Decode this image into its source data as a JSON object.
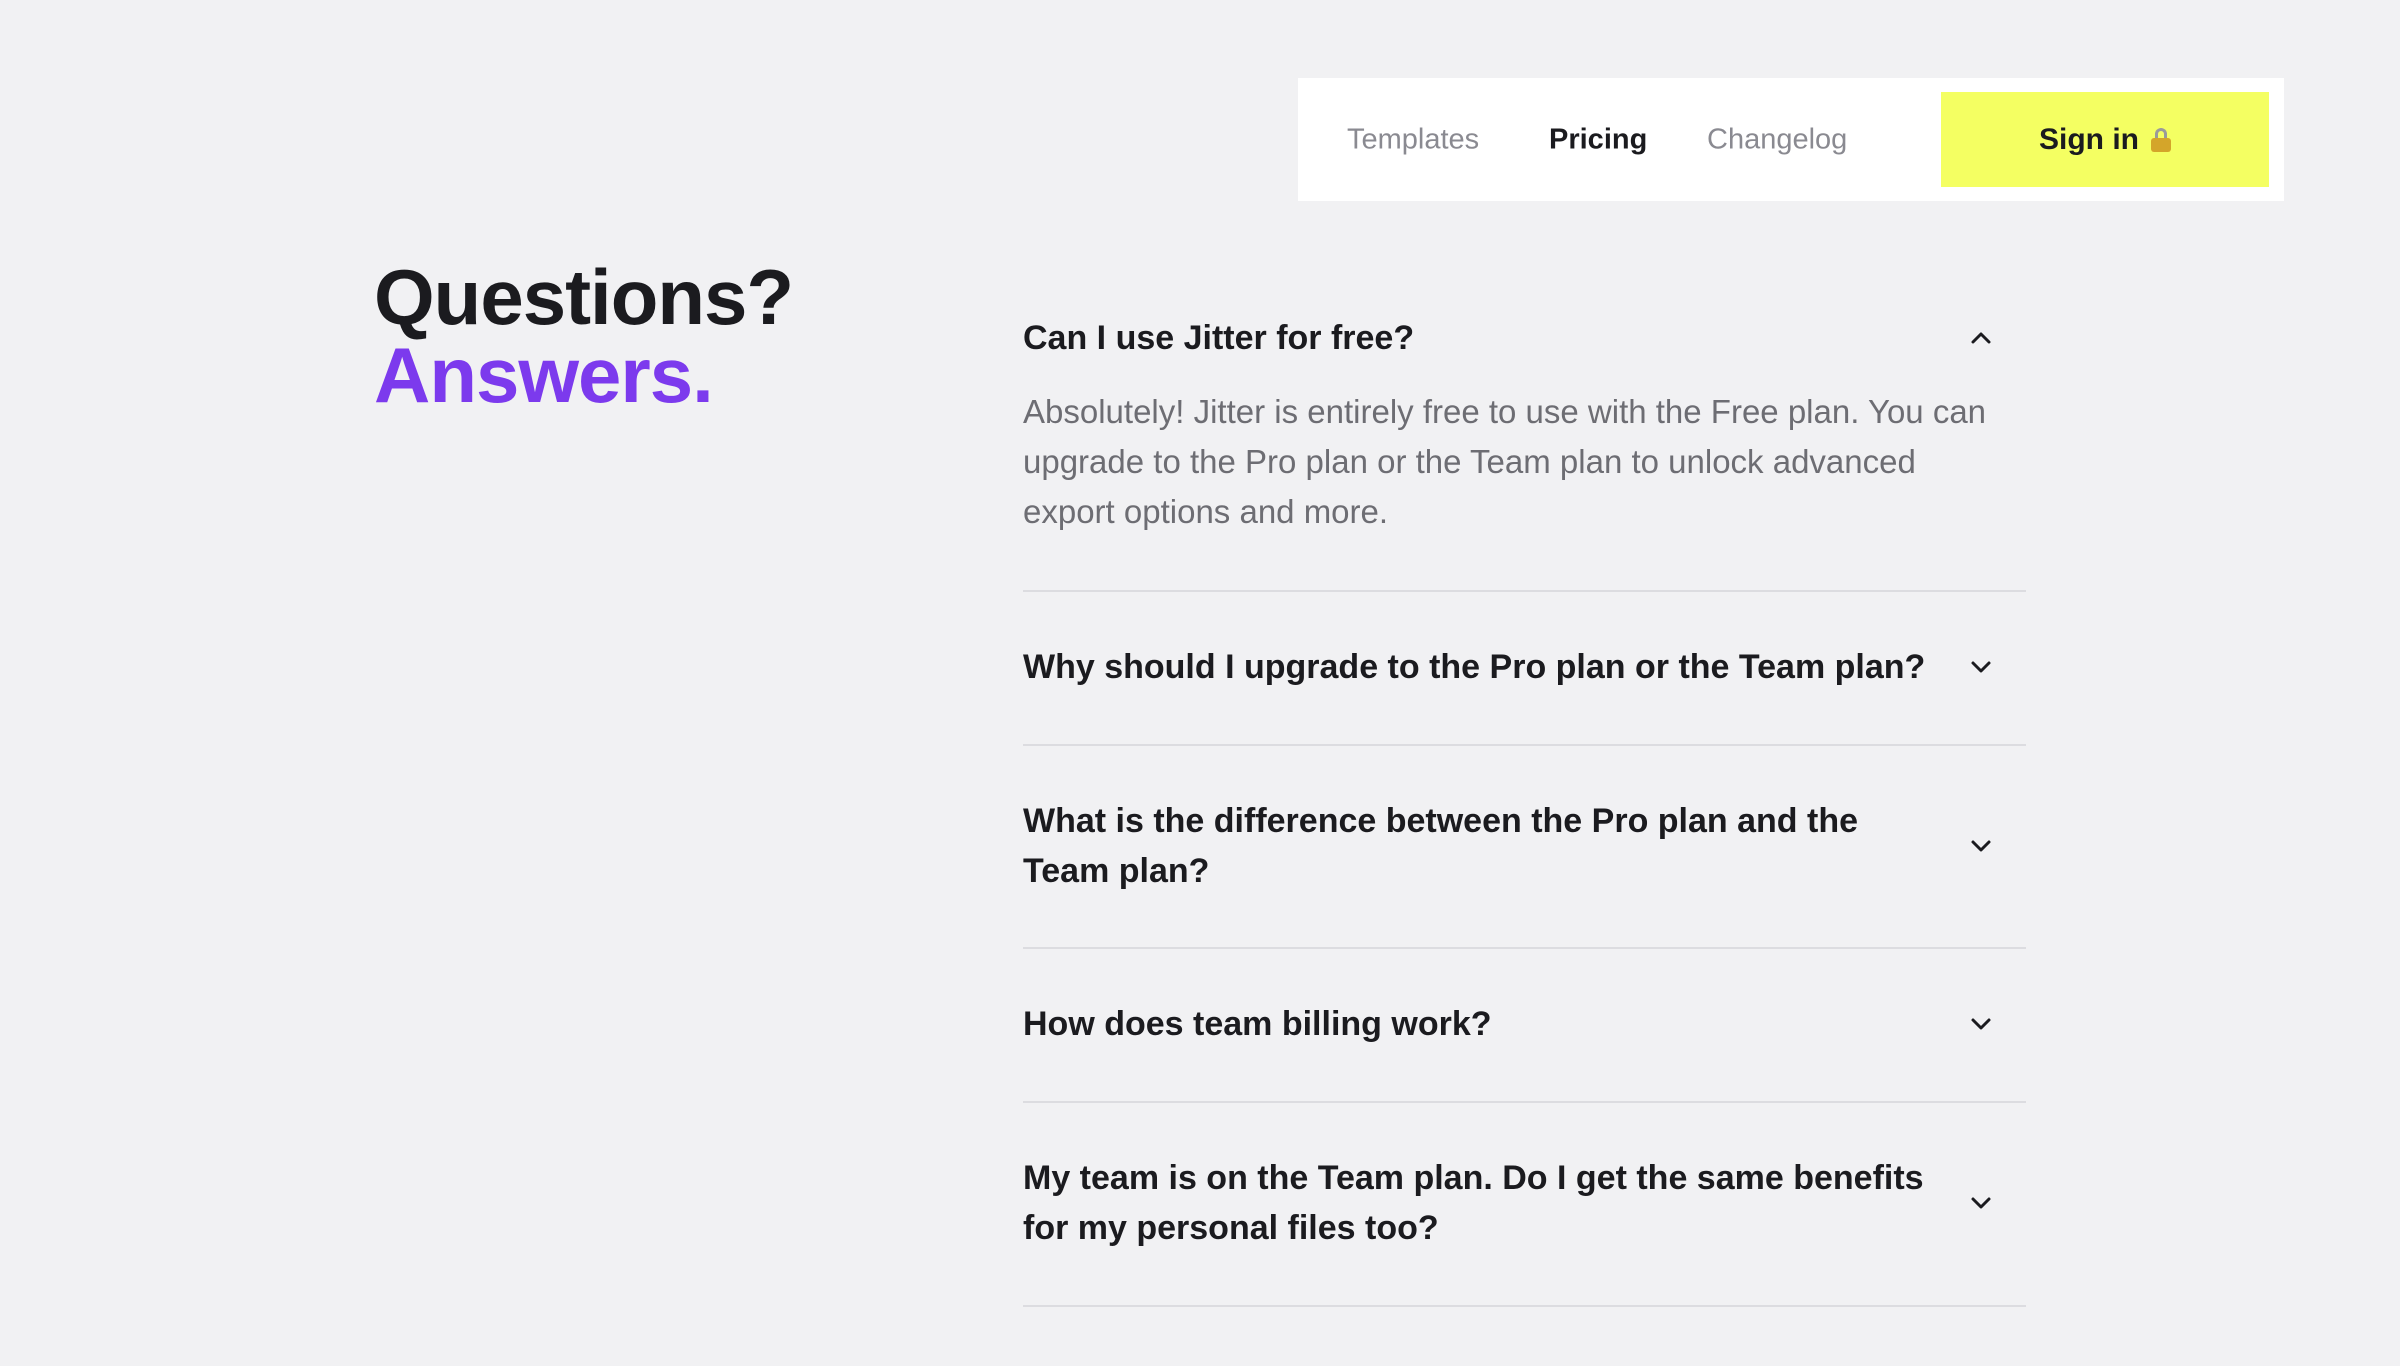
{
  "nav": {
    "links": [
      {
        "label": "Templates",
        "active": false
      },
      {
        "label": "Pricing",
        "active": true
      },
      {
        "label": "Changelog",
        "active": false
      }
    ],
    "signin_label": "Sign in",
    "signin_icon": "lock-icon",
    "signin_color": "#f4ff62"
  },
  "heading": {
    "line1": "Questions?",
    "line2": "Answers.",
    "accent_color": "#7c3aed"
  },
  "faq": [
    {
      "question": "Can I use Jitter for free?",
      "answer": "Absolutely! Jitter is entirely free to use with the Free plan. You can upgrade to the Pro plan or the Team plan to unlock advanced export options and more.",
      "expanded": true,
      "icon": "chevron-up-icon"
    },
    {
      "question": "Why should I upgrade to the Pro plan or the Team plan?",
      "expanded": false,
      "icon": "chevron-down-icon"
    },
    {
      "question": "What is the difference between the Pro plan and the Team plan?",
      "expanded": false,
      "icon": "chevron-down-icon"
    },
    {
      "question": "How does team billing work?",
      "expanded": false,
      "icon": "chevron-down-icon"
    },
    {
      "question": "My team is on the Team plan. Do I get the same benefits for my personal files too?",
      "expanded": false,
      "icon": "chevron-down-icon"
    }
  ]
}
